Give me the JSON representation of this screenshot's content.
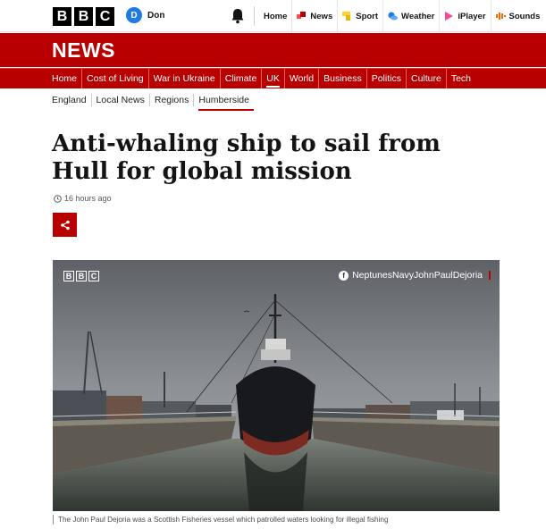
{
  "brand": {
    "letters": [
      "B",
      "B",
      "C"
    ]
  },
  "account": {
    "initial": "D",
    "name": "Don"
  },
  "topnav": {
    "items": [
      {
        "label": "Home",
        "icon": "home"
      },
      {
        "label": "News",
        "icon": "news-icon",
        "color": "#ff4c4c"
      },
      {
        "label": "Sport",
        "icon": "sport-icon",
        "color": "#ffd230"
      },
      {
        "label": "Weather",
        "icon": "weather-icon",
        "color": "#1e7be6"
      },
      {
        "label": "iPlayer",
        "icon": "iplayer-icon",
        "color": "#f54997"
      },
      {
        "label": "Sounds",
        "icon": "sounds-icon",
        "color": "#ff6600"
      }
    ]
  },
  "news_banner": {
    "title": "NEWS",
    "color": "#b80000"
  },
  "category_nav": {
    "items": [
      "Home",
      "Cost of Living",
      "War in Ukraine",
      "Climate",
      "UK",
      "World",
      "Business",
      "Politics",
      "Culture",
      "Tech"
    ],
    "active": "UK"
  },
  "sub_nav": {
    "items": [
      "England",
      "Local News",
      "Regions",
      "Humberside"
    ],
    "active": "Humberside"
  },
  "article": {
    "headline": "Anti-whaling ship to sail from Hull for global mission",
    "timestamp": "16 hours ago",
    "image_watermark": [
      "B",
      "B",
      "C"
    ],
    "image_credit": "NeptunesNavyJohnPaulDejoria",
    "caption": "The John Paul Dejoria was a Scottish Fisheries vessel which patrolled waters looking for illegal fishing"
  }
}
